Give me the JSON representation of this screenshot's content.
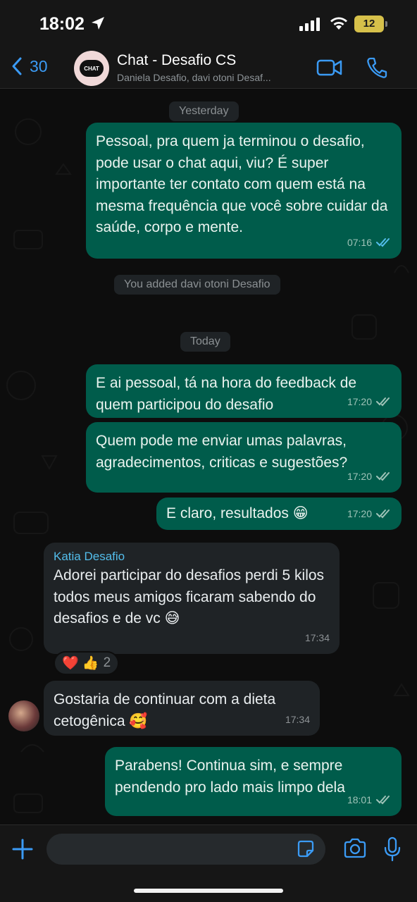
{
  "status_bar": {
    "time": "18:02",
    "battery": "12"
  },
  "header": {
    "back_count": "30",
    "avatar_text": "CHAT",
    "title": "Chat - Desafio CS",
    "subtitle": "Daniela Desafio, davi otoni Desaf..."
  },
  "chat": {
    "date_yesterday": "Yesterday",
    "date_today": "Today",
    "system_added": "You added davi otoni Desafio",
    "messages": [
      {
        "text": "Pessoal, pra quem ja terminou o desafio, pode usar o chat aqui, viu? É super importante ter contato com quem está na mesma frequência que você sobre cuidar da saúde, corpo e mente.",
        "time": "07:16",
        "read": true
      },
      {
        "text": "E ai pessoal, tá na hora do feedback de quem participou do desafio",
        "time": "17:20",
        "read": false
      },
      {
        "text": "Quem pode me enviar umas palavras, agradecimentos, criticas e sugestões?",
        "time": "17:20",
        "read": false
      },
      {
        "text": "E claro, resultados 😁",
        "time": "17:20",
        "read": false
      },
      {
        "sender": "Katia Desafio",
        "text": "Adorei participar do desafios  perdi 5 kilos todos meus amigos ficaram sabendo do desafios e de vc 😅",
        "time": "17:34"
      },
      {
        "text": "Gostaria de continuar com a dieta cetogênica 🥰",
        "time": "17:34"
      },
      {
        "text": "Parabens! Continua sim, e sempre pendendo pro lado mais limpo dela",
        "time": "18:01",
        "read": false
      }
    ],
    "reaction": {
      "emojis": "❤️ 👍",
      "count": "2"
    }
  },
  "colors": {
    "accent": "#3b9bf5",
    "outgoing_bubble": "#005c4b",
    "incoming_bubble": "#1f2326",
    "read_tick": "#53bdeb",
    "sender_name": "#53bdeb"
  },
  "icons": [
    "location-arrow-icon",
    "signal-icon",
    "wifi-icon",
    "battery-icon",
    "back-chevron-icon",
    "video-call-icon",
    "phone-icon",
    "plus-icon",
    "sticker-icon",
    "camera-icon",
    "microphone-icon",
    "double-check-icon"
  ]
}
